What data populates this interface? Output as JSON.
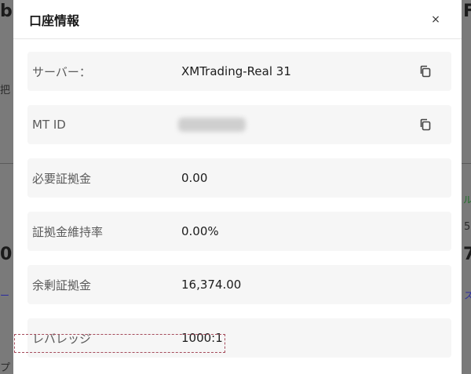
{
  "modal": {
    "title": "口座情報",
    "close_label": "×"
  },
  "rows": [
    {
      "label": "サーバー：",
      "value": "XMTrading-Real 31",
      "copy": true
    },
    {
      "label": "MT ID",
      "value": "",
      "copy": true
    },
    {
      "label": "必要証拠金",
      "value": "0.00",
      "copy": false
    },
    {
      "label": "証拠金維持率",
      "value": "0.00%",
      "copy": false
    },
    {
      "label": "余剰証拠金",
      "value": "16,374.00",
      "copy": false
    },
    {
      "label": "レバレッジ",
      "value": "1000:1",
      "copy": false
    }
  ],
  "background": {
    "left_fragments": [
      "bl",
      "把",
      "0",
      "ー",
      "プ"
    ],
    "right_fragments": [
      "F",
      "ル",
      "5",
      "7",
      "ス"
    ]
  }
}
